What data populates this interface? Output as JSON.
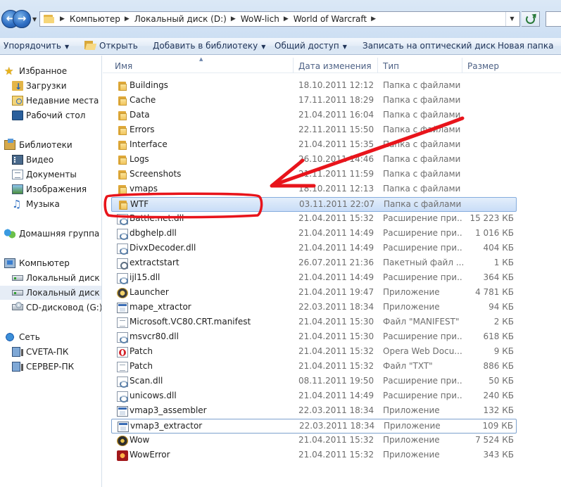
{
  "address_bar": {
    "crumbs": [
      "Компьютер",
      "Локальный диск (D:)",
      "WoW-lich",
      "World of Warcraft"
    ]
  },
  "toolbar": {
    "organize": "Упорядочить",
    "open": "Открыть",
    "add_to_library": "Добавить в библиотеку",
    "share": "Общий доступ",
    "burn": "Записать на оптический диск",
    "new_folder": "Новая папка"
  },
  "nav": {
    "favorites": "Избранное",
    "downloads": "Загрузки",
    "recent": "Недавние места",
    "desktop": "Рабочий стол",
    "libraries": "Библиотеки",
    "video": "Видео",
    "documents": "Документы",
    "pictures": "Изображения",
    "music": "Музыка",
    "homegroup": "Домашняя группа",
    "computer": "Компьютер",
    "drive_c": "Локальный диск (C",
    "drive_d": "Локальный диск (D",
    "cd_drive": "CD-дисковод (G:)",
    "network": "Сеть",
    "pc1": "CVETA-ПК",
    "pc2": "СЕРВЕР-ПК"
  },
  "columns": {
    "name": "Имя",
    "date": "Дата изменения",
    "type": "Тип",
    "size": "Размер"
  },
  "files": [
    {
      "name": "Buildings",
      "date": "18.10.2011 12:12",
      "type": "Папка с файлами",
      "size": "",
      "icon": "folder-icon"
    },
    {
      "name": "Cache",
      "date": "17.11.2011 18:29",
      "type": "Папка с файлами",
      "size": "",
      "icon": "folder-icon"
    },
    {
      "name": "Data",
      "date": "21.04.2011 16:04",
      "type": "Папка с файлами",
      "size": "",
      "icon": "folder-icon"
    },
    {
      "name": "Errors",
      "date": "22.11.2011 15:50",
      "type": "Папка с файлами",
      "size": "",
      "icon": "folder-icon"
    },
    {
      "name": "Interface",
      "date": "21.04.2011 15:35",
      "type": "Папка с файлами",
      "size": "",
      "icon": "folder-icon"
    },
    {
      "name": "Logs",
      "date": "26.10.2011 14:46",
      "type": "Папка с файлами",
      "size": "",
      "icon": "folder-icon"
    },
    {
      "name": "Screenshots",
      "date": "21.11.2011 11:59",
      "type": "Папка с файлами",
      "size": "",
      "icon": "folder-icon"
    },
    {
      "name": "vmaps",
      "date": "18.10.2011 12:13",
      "type": "Папка с файлами",
      "size": "",
      "icon": "folder-icon"
    },
    {
      "name": "WTF",
      "date": "03.11.2011 22:07",
      "type": "Папка с файлами",
      "size": "",
      "icon": "folder-icon"
    },
    {
      "name": "Battle.net.dll",
      "date": "21.04.2011 15:32",
      "type": "Расширение при...",
      "size": "15 223 КБ",
      "icon": "dll-icon"
    },
    {
      "name": "dbghelp.dll",
      "date": "21.04.2011 14:49",
      "type": "Расширение при...",
      "size": "1 016 КБ",
      "icon": "dll-icon"
    },
    {
      "name": "DivxDecoder.dll",
      "date": "21.04.2011 14:49",
      "type": "Расширение при...",
      "size": "404 КБ",
      "icon": "dll-icon"
    },
    {
      "name": "extractstart",
      "date": "26.07.2011 21:36",
      "type": "Пакетный файл ...",
      "size": "1 КБ",
      "icon": "batch-icon"
    },
    {
      "name": "ijl15.dll",
      "date": "21.04.2011 14:49",
      "type": "Расширение при...",
      "size": "364 КБ",
      "icon": "dll-icon"
    },
    {
      "name": "Launcher",
      "date": "21.04.2011 19:47",
      "type": "Приложение",
      "size": "4 781 КБ",
      "icon": "launcher-icon"
    },
    {
      "name": "mape_xtractor",
      "date": "22.03.2011 18:34",
      "type": "Приложение",
      "size": "94 КБ",
      "icon": "app-icon"
    },
    {
      "name": "Microsoft.VC80.CRT.manifest",
      "date": "21.04.2011 15:30",
      "type": "Файл \"MANIFEST\"",
      "size": "2 КБ",
      "icon": "document-icon"
    },
    {
      "name": "msvcr80.dll",
      "date": "21.04.2011 15:30",
      "type": "Расширение при...",
      "size": "618 КБ",
      "icon": "dll-icon"
    },
    {
      "name": "Patch",
      "date": "21.04.2011 15:32",
      "type": "Opera Web Docu...",
      "size": "9 КБ",
      "icon": "opera-icon"
    },
    {
      "name": "Patch",
      "date": "21.04.2011 15:32",
      "type": "Файл \"TXT\"",
      "size": "886 КБ",
      "icon": "document-icon"
    },
    {
      "name": "Scan.dll",
      "date": "08.11.2011 19:50",
      "type": "Расширение при...",
      "size": "50 КБ",
      "icon": "dll-icon"
    },
    {
      "name": "unicows.dll",
      "date": "21.04.2011 14:49",
      "type": "Расширение при...",
      "size": "240 КБ",
      "icon": "dll-icon"
    },
    {
      "name": "vmap3_assembler",
      "date": "22.03.2011 18:34",
      "type": "Приложение",
      "size": "132 КБ",
      "icon": "app-icon"
    },
    {
      "name": "vmap3_extractor",
      "date": "22.03.2011 18:34",
      "type": "Приложение",
      "size": "109 КБ",
      "icon": "app-icon"
    },
    {
      "name": "Wow",
      "date": "21.04.2011 15:32",
      "type": "Приложение",
      "size": "7 524 КБ",
      "icon": "wow-icon"
    },
    {
      "name": "WowError",
      "date": "21.04.2011 15:32",
      "type": "Приложение",
      "size": "343 КБ",
      "icon": "wowerror-icon"
    }
  ],
  "selected_file": "WTF",
  "focused_file": "vmap3_extractor",
  "colors": {
    "annotation": "#e8141b",
    "selection_border": "#84acdd",
    "header_text": "#4d6185"
  }
}
